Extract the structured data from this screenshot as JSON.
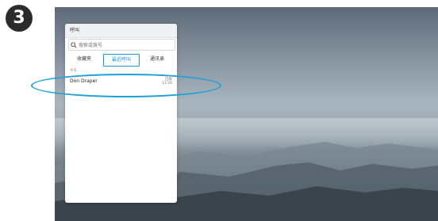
{
  "step_number": "3",
  "panel": {
    "title": "呼叫",
    "search_placeholder": "搜索或拨号",
    "tabs": [
      {
        "label": "收藏夹",
        "active": false
      },
      {
        "label": "最近呼叫",
        "active": true
      },
      {
        "label": "通讯录",
        "active": false
      }
    ],
    "section_label": "今天",
    "entries": [
      {
        "name": "Don Draper",
        "status": "已接",
        "time": "11:26"
      }
    ]
  },
  "colors": {
    "accent": "#1a9ad7",
    "highlight_ring": "#1ea0dc",
    "badge": "#2b2b2b"
  },
  "icons": {
    "search": "search-icon"
  }
}
